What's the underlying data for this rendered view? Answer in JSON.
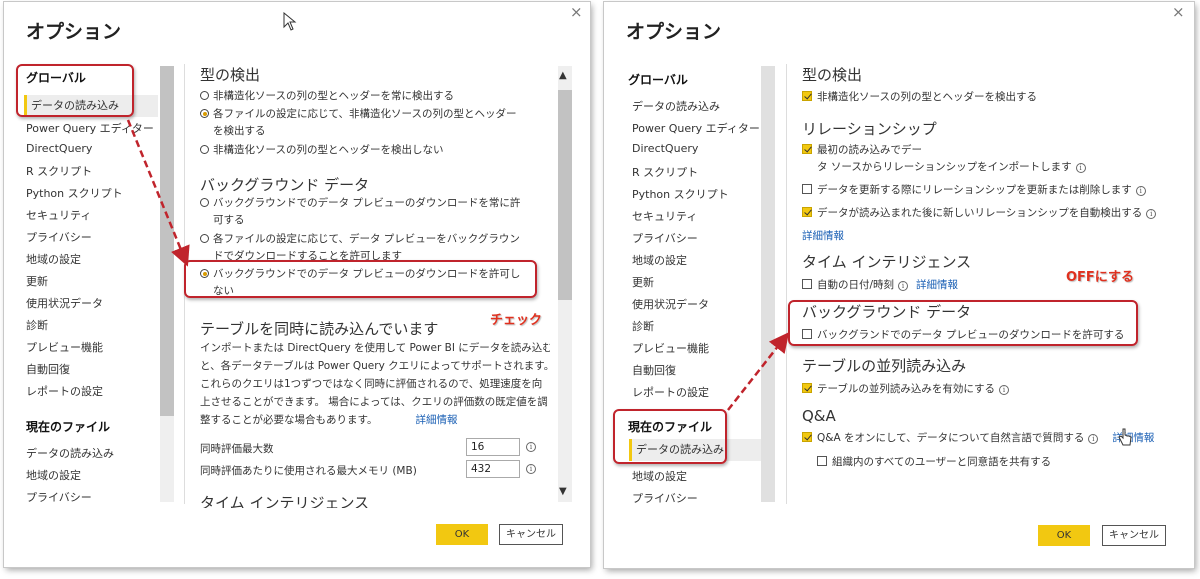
{
  "left": {
    "title": "オプション",
    "close": "×",
    "global_header": "グローバル",
    "global_items": [
      "データの読み込み",
      "Power Query エディター",
      "DirectQuery",
      "R スクリプト",
      "Python スクリプト",
      "セキュリティ",
      "プライバシー",
      "地域の設定",
      "更新",
      "使用状況データ",
      "診断",
      "プレビュー機能",
      "自動回復",
      "レポートの設定"
    ],
    "current_header": "現在のファイル",
    "current_items": [
      "データの読み込み",
      "地域の設定",
      "プライバシー"
    ],
    "type_detection": {
      "title": "型の検出",
      "options": [
        "非構造化ソースの列の型とヘッダーを常に検出する",
        "各ファイルの設定に応じて、非構造化ソースの列の型とヘッダー",
        "を検出する",
        "非構造化ソースの列の型とヘッダーを検出しない"
      ]
    },
    "background": {
      "title": "バックグラウンド データ",
      "options": [
        "バックグラウンドでのデータ プレビューのダウンロードを常に許",
        "可する",
        "各ファイルの設定に応じて、データ プレビューをバックグラウン",
        "ドでダウンロードすることを許可します",
        "バックグラウンドでのデータ プレビューのダウンロードを許可し",
        "ない"
      ]
    },
    "parallel": {
      "title": "テーブルを同時に読み込んでいます",
      "paragraph": [
        "インポートまたは DirectQuery を使用して Power BI にデータを読み込む",
        "と、各データテーブルは Power Query クエリによってサポートされます。",
        "これらのクエリは1つずつではなく同時に評価されるので、処理速度を向",
        "上させることができます。 場合によっては、クエリの評価数の既定値を調",
        "整することが必要な場合もあります。"
      ],
      "learn_more": "詳細情報",
      "max_eval_label": "同時評価最大数",
      "max_eval_value": "16",
      "max_mem_label": "同時評価あたりに使用される最大メモリ (MB)",
      "max_mem_value": "432"
    },
    "next_section": "タイム インテリジェンス",
    "ok": "OK",
    "cancel": "キャンセル",
    "annotation": "チェック"
  },
  "right": {
    "title": "オプション",
    "close": "×",
    "global_header": "グローバル",
    "global_items": [
      "データの読み込み",
      "Power Query エディター",
      "DirectQuery",
      "R スクリプト",
      "Python スクリプト",
      "セキュリティ",
      "プライバシー",
      "地域の設定",
      "更新",
      "使用状況データ",
      "診断",
      "プレビュー機能",
      "自動回復",
      "レポートの設定"
    ],
    "current_header": "現在のファイル",
    "current_items": [
      "データの読み込み",
      "地域の設定",
      "プライバシー"
    ],
    "type_detection": {
      "title": "型の検出",
      "opt1": "非構造化ソースの列の型とヘッダーを検出する"
    },
    "relationships": {
      "title": "リレーションシップ",
      "opt1a": "最初の読み込みでデー",
      "opt1b": "タ ソースからリレーションシップをインポートします",
      "opt2": "データを更新する際にリレーションシップを更新または削除します",
      "opt3": "データが読み込まれた後に新しいリレーションシップを自動検出する",
      "learn_more": "詳細情報"
    },
    "time_intel": {
      "title": "タイム インテリジェンス",
      "opt1": "自動の日付/時刻",
      "learn_more": "詳細情報"
    },
    "background": {
      "title": "バックグラウンド データ",
      "opt1": "バックグランドでのデータ プレビューのダウンロードを許可する"
    },
    "parallel": {
      "title": "テーブルの並列読み込み",
      "opt1": "テーブルの並列読み込みを有効にする"
    },
    "qa": {
      "title": "Q&A",
      "opt1": "Q&A をオンにして、データについて自然言語で質問する",
      "learn_more": "詳細情報",
      "opt2": "組織内のすべてのユーザーと同意語を共有する"
    },
    "ok": "OK",
    "cancel": "キャンセル",
    "annotation": "OFFにする"
  },
  "colors": {
    "accent": "#f2c811",
    "highlight": "#c0242c",
    "annotation": "#e0301e",
    "link": "#1a5fb4"
  }
}
